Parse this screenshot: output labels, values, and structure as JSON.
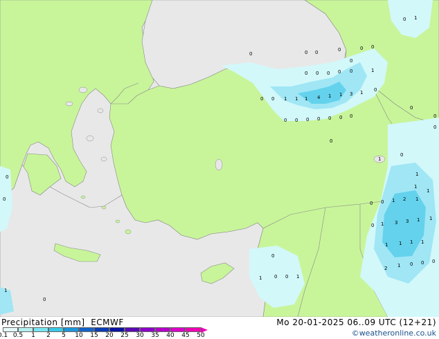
{
  "title": "Precipitation [mm]",
  "model": "ECMWF",
  "valid_time": "Mo 20-01-2025 06..09 UTC (12+21)",
  "credit": "©weatheronline.co.uk",
  "legend": {
    "labels": [
      "0.1",
      "0.5",
      "1",
      "2",
      "5",
      "10",
      "15",
      "20",
      "25",
      "30",
      "35",
      "40",
      "45",
      "50"
    ],
    "colors": [
      "#e6fafa",
      "#b4f0f0",
      "#78e6f0",
      "#3cc8e6",
      "#1e96dc",
      "#1464c8",
      "#0a3cb4",
      "#0a14a0",
      "#5a0ab4",
      "#8c00c8",
      "#b400c8",
      "#dc00c8",
      "#f000b4"
    ]
  },
  "colors": {
    "land": "#c8f59a",
    "sea": "#e8e8e8",
    "border": "#888888",
    "precip_light": "#d2f8fa",
    "precip_mid": "#a0e6f5",
    "precip_heavy": "#64d2ec"
  },
  "station_values": [
    {
      "id": "black-sea-1",
      "text": "0"
    },
    {
      "id": "black-sea-2",
      "text": "0"
    },
    {
      "id": "black-sea-3",
      "text": "0"
    },
    {
      "id": "ne-turkey-1",
      "text": "1"
    },
    {
      "id": "ne-turkey-2",
      "text": "1"
    },
    {
      "id": "ne-turkey-3",
      "text": "1"
    },
    {
      "id": "ne-turkey-4",
      "text": "4"
    },
    {
      "id": "ne-turkey-5",
      "text": "1"
    },
    {
      "id": "ne-turkey-6",
      "text": "1"
    },
    {
      "id": "ne-turkey-7",
      "text": "3"
    },
    {
      "id": "ne-turkey-8",
      "text": "1"
    },
    {
      "id": "ne-turkey-9",
      "text": "0"
    },
    {
      "id": "ne-turkey-10",
      "text": "0"
    },
    {
      "id": "ne-turkey-11",
      "text": "0"
    },
    {
      "id": "ne-turkey-12",
      "text": "0"
    },
    {
      "id": "ne-turkey-13",
      "text": "0"
    },
    {
      "id": "ne-turkey-14",
      "text": "0"
    },
    {
      "id": "ne-turkey-15",
      "text": "0"
    },
    {
      "id": "ne-turkey-16",
      "text": "0"
    },
    {
      "id": "ne-turkey-17",
      "text": "0"
    },
    {
      "id": "ne-turkey-18",
      "text": "0"
    },
    {
      "id": "ne-turkey-19",
      "text": "0"
    },
    {
      "id": "ne-turkey-20",
      "text": "0"
    },
    {
      "id": "ne-turkey-21",
      "text": "0"
    },
    {
      "id": "ne-turkey-22",
      "text": "0"
    },
    {
      "id": "ne-turkey-23",
      "text": "0"
    },
    {
      "id": "caucasus-1",
      "text": "0"
    },
    {
      "id": "caucasus-2",
      "text": "1"
    },
    {
      "id": "caucasus-3",
      "text": "0"
    },
    {
      "id": "caucasus-4",
      "text": "0"
    },
    {
      "id": "caucasus-5",
      "text": "0"
    },
    {
      "id": "caucasus-6",
      "text": "0"
    },
    {
      "id": "topright-1",
      "text": "0"
    },
    {
      "id": "topright-2",
      "text": "1"
    },
    {
      "id": "east-1",
      "text": "0"
    },
    {
      "id": "east-2",
      "text": "0"
    },
    {
      "id": "east-3",
      "text": "0"
    },
    {
      "id": "east-4",
      "text": "1"
    },
    {
      "id": "iraq-1",
      "text": "0"
    },
    {
      "id": "iraq-2",
      "text": "1"
    },
    {
      "id": "iraq-3",
      "text": "2"
    },
    {
      "id": "iraq-4",
      "text": "0"
    },
    {
      "id": "iraq-5",
      "text": "1"
    },
    {
      "id": "iraq-6",
      "text": "1"
    },
    {
      "id": "iraq-7",
      "text": "3"
    },
    {
      "id": "iraq-8",
      "text": "3"
    },
    {
      "id": "iraq-9",
      "text": "1"
    },
    {
      "id": "iraq-10",
      "text": "1"
    },
    {
      "id": "iraq-11",
      "text": "0"
    },
    {
      "id": "iraq-12",
      "text": "1"
    },
    {
      "id": "iraq-13",
      "text": "1"
    },
    {
      "id": "iraq-14",
      "text": "1"
    },
    {
      "id": "iraq-15",
      "text": "2"
    },
    {
      "id": "iraq-16",
      "text": "1"
    },
    {
      "id": "iraq-17",
      "text": "0"
    },
    {
      "id": "iraq-18",
      "text": "0"
    },
    {
      "id": "iraq-19",
      "text": "1"
    },
    {
      "id": "iraq-20",
      "text": "1"
    },
    {
      "id": "iraq-21",
      "text": "0"
    },
    {
      "id": "iraq-22",
      "text": "1"
    },
    {
      "id": "iraq-23",
      "text": "1"
    },
    {
      "id": "iraq-24",
      "text": "0"
    },
    {
      "id": "levant-1",
      "text": "0"
    },
    {
      "id": "levant-2",
      "text": "1"
    },
    {
      "id": "levant-3",
      "text": "0"
    },
    {
      "id": "levant-4",
      "text": "0"
    },
    {
      "id": "levant-5",
      "text": "1"
    },
    {
      "id": "west-1",
      "text": "0"
    },
    {
      "id": "west-2",
      "text": "0"
    },
    {
      "id": "west-3",
      "text": "0"
    },
    {
      "id": "west-4",
      "text": "1"
    }
  ]
}
